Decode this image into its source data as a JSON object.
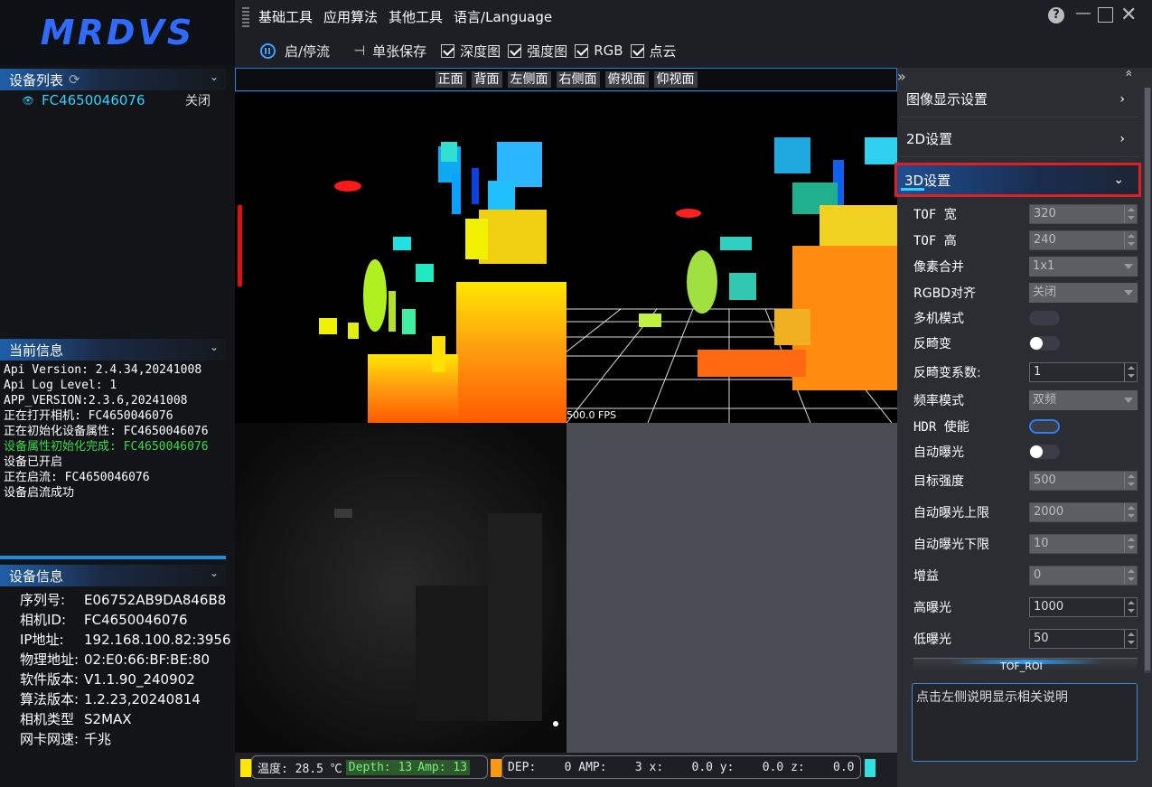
{
  "logo": "MRDVS",
  "left": {
    "device_list_title": "设备列表",
    "device": {
      "serial": "FC4650046076",
      "state": "关闭"
    },
    "current_info_title": "当前信息",
    "log": [
      {
        "text": "Api Version: 2.4.34,20241008",
        "ok": false
      },
      {
        "text": "Api Log Level: 1",
        "ok": false
      },
      {
        "text": "APP_VERSION:2.3.6,20241008",
        "ok": false
      },
      {
        "text": "正在打开相机: FC4650046076",
        "ok": false
      },
      {
        "text": "正在初始化设备属性: FC4650046076",
        "ok": false
      },
      {
        "text": "设备属性初始化完成: FC4650046076",
        "ok": true
      },
      {
        "text": "设备已开启",
        "ok": false
      },
      {
        "text": "正在启流: FC4650046076",
        "ok": false
      },
      {
        "text": "设备启流成功",
        "ok": false
      }
    ],
    "device_info_title": "设备信息",
    "device_info": [
      {
        "k": "序列号:",
        "v": "E06752AB9DA846B8"
      },
      {
        "k": "相机ID:",
        "v": "FC4650046076"
      },
      {
        "k": "IP地址:",
        "v": "192.168.100.82:3956"
      },
      {
        "k": "物理地址:",
        "v": "02:E0:66:BF:BE:80"
      },
      {
        "k": "软件版本:",
        "v": "V1.1.90_240902"
      },
      {
        "k": "算法版本:",
        "v": "1.2.23,20240814"
      },
      {
        "k": "相机类型",
        "v": "S2MAX"
      },
      {
        "k": "网卡网速:",
        "v": "千兆"
      }
    ]
  },
  "menu": [
    "基础工具",
    "应用算法",
    "其他工具",
    "语言/Language"
  ],
  "toolbar": {
    "start_stop": "启/停流",
    "single_save": "单张保存",
    "checks": [
      "深度图",
      "强度图",
      "RGB",
      "点云"
    ]
  },
  "views": [
    "正面",
    "背面",
    "左侧面",
    "右侧面",
    "俯视面",
    "仰视面"
  ],
  "fps": "500.0 FPS",
  "status": {
    "temp": "温度: 28.5 ℃",
    "depth": "Depth: 13",
    "amp": "Amp: 13",
    "readout": "DEP:    0 AMP:    3 x:    0.0 y:    0.0 z:    0.0"
  },
  "right": {
    "image_display": "图像显示设置",
    "settings_2d": "2D设置",
    "settings_3d": "3D设置",
    "tof_width_label": "TOF 宽",
    "tof_width": "320",
    "tof_height_label": "TOF 高",
    "tof_height": "240",
    "binning_label": "像素合并",
    "binning": "1x1",
    "rgbd_label": "RGBD对齐",
    "rgbd": "关闭",
    "multi_label": "多机模式",
    "undistort_label": "反畸变",
    "undistort_coef_label": "反畸变系数:",
    "undistort_coef": "1",
    "freq_label": "频率模式",
    "freq": "双频",
    "hdr_label": "HDR 使能",
    "auto_exp_label": "自动曝光",
    "target_label": "目标强度",
    "target": "500",
    "ae_upper_label": "自动曝光上限",
    "ae_upper": "2000",
    "ae_lower_label": "自动曝光下限",
    "ae_lower": "10",
    "gain_label": "增益",
    "gain": "0",
    "high_exp_label": "高曝光",
    "high_exp": "1000",
    "low_exp_label": "低曝光",
    "low_exp": "50",
    "tof_roi": "TOF_ROI",
    "explain": "点击左侧说明显示相关说明"
  },
  "colors": {
    "accent": "#2ad3ff",
    "highlight": "#e02020",
    "logo": "#2f6bff",
    "ok": "#38d94a"
  }
}
